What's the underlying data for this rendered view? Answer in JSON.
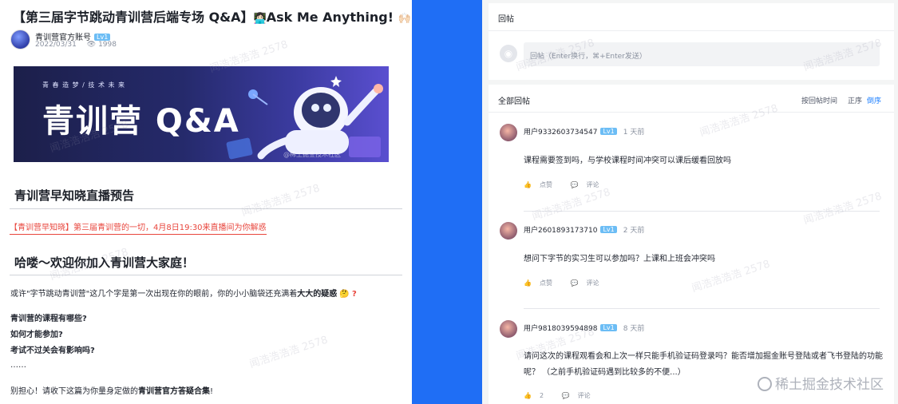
{
  "article": {
    "title": "【第三届字节跳动青训营后端专场 Q&A】",
    "title_suffix": "Ask Me Anything!",
    "author": "青训营官方账号",
    "level": "Lv1",
    "date": "2022/03/31",
    "views": "1998",
    "banner": {
      "slogan": "青 春 造 梦 / 技 术 未 来",
      "headline": "青训营 Q&A",
      "watermark": "@稀土掘金技术社区"
    },
    "section1_heading": "青训营早知晓直播预告",
    "live_link": "【青训营早知晓】第三届青训营的一切，4月8日19:30来直播间为你解惑",
    "section2_heading": "哈喽～欢迎你加入青训营大家庭！",
    "intro_pre": "或许\"字节跳动青训营\"这几个字是第一次出现在你的眼前，你的小小脑袋还充满着",
    "intro_bold": "大大的疑惑",
    "intro_q": "?",
    "questions": [
      "青训营的课程有哪些?",
      "如何才能参加?",
      "考试不过关会有影响吗?"
    ],
    "ellipsis": "……",
    "closing_pre": "别担心！请收下这篇为你量身定做的",
    "closing_bold": "青训营官方答疑合集",
    "closing_post": "!"
  },
  "watermark_text": "闻浩浩浩浩 2578",
  "reply": {
    "title": "回帖",
    "placeholder": "回帖（Enter换行，⌘+Enter发送）"
  },
  "comments_section": {
    "title": "全部回帖",
    "sort_time": "按回帖时间",
    "sort_asc": "正序",
    "sort_desc": "倒序",
    "accent_color": "#1e80ff"
  },
  "comments": [
    {
      "user": "用户9332603734547",
      "level": "Lv1",
      "time": "1 天前",
      "text": "课程需要签到吗，与学校课程时间冲突可以课后缓看回放吗",
      "like": "点赞",
      "comment": "评论"
    },
    {
      "user": "用户2601893173710",
      "level": "Lv1",
      "time": "2 天前",
      "text": "想问下字节的实习生可以参加吗？上课和上班会冲突吗",
      "like": "点赞",
      "comment": "评论"
    },
    {
      "user": "用户9818039594898",
      "level": "Lv1",
      "time": "8 天前",
      "text": "请问这次的课程观看会和上次一样只能手机验证码登录吗？能否增加掘金账号登陆或者飞书登陆的功能",
      "text2": "呢？ （之前手机验证码遇到比较多的不便...）",
      "like": "2",
      "comment": "评论"
    }
  ],
  "site_watermark": "稀土掘金技术社区"
}
